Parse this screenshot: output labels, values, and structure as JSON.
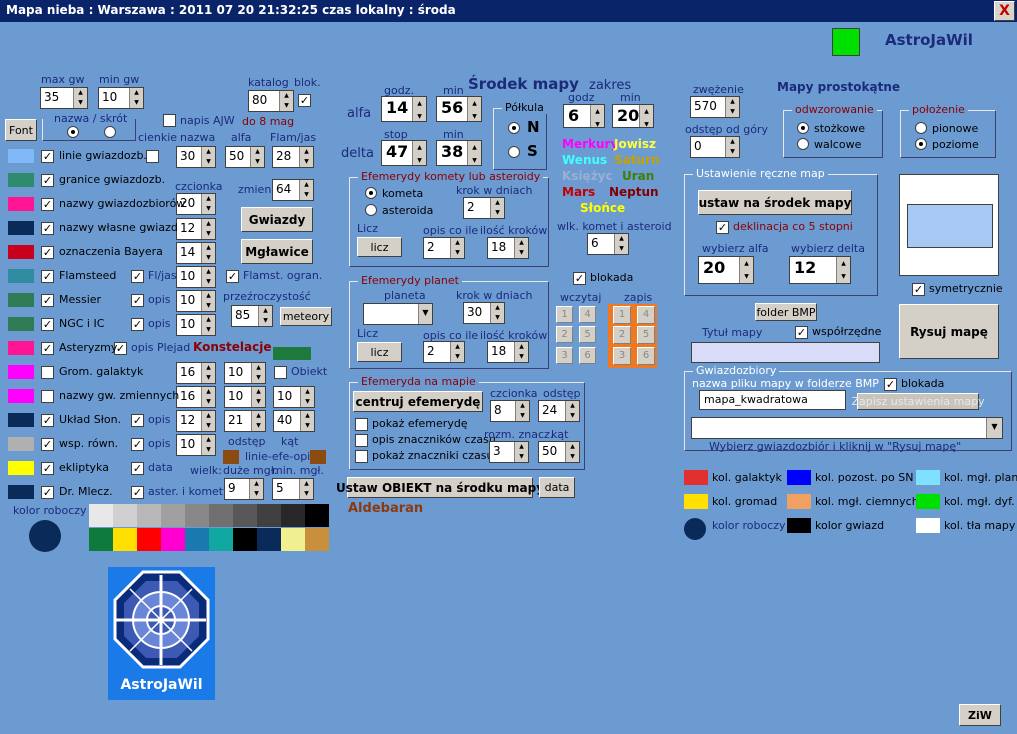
{
  "window": {
    "title": "Mapa nieba  :  Warszawa  :  2011 07 20   21:32:25  czas lokalny  :  środa",
    "close": "X",
    "brand": "AstroJaWil"
  },
  "left": {
    "max_gw_label": "max gw",
    "max_gw": "35",
    "min_gw_label": "min gw",
    "min_gw": "10",
    "katalog_label": "katalog",
    "katalog": "80",
    "blok_label": "blok.",
    "do8mag": "do 8 mag",
    "font_button": "Font",
    "nazwa_skrot": "nazwa / skrót",
    "napis_ajw": "napis AJW",
    "cienkie": "cienkie",
    "nazwa_col": "nazwa",
    "alfa_col": "alfa",
    "flam_jas_col": "Flam/jas",
    "linie_vals": [
      "30",
      "50",
      "28"
    ],
    "czcionka": "czcionka",
    "czcionka_val": "20",
    "zmien": "zmien.",
    "zmien_val": "64",
    "gwiazdy_btn": "Gwiazdy",
    "mglawice_btn": "Mgławice",
    "rows": [
      {
        "label": "linie gwiazdozb.",
        "color": "#80b8f8",
        "checked": true
      },
      {
        "label": "granice gwiazdozb.",
        "color": "#2e8b6e",
        "checked": true
      },
      {
        "label": "nazwy gwiazdozbiorów",
        "color": "#ff1493",
        "checked": true
      },
      {
        "label": "nazwy własne gwiazd",
        "color": "#0a2a5a",
        "checked": true
      },
      {
        "label": "oznaczenia Bayera",
        "color": "#c8001e",
        "checked": true
      },
      {
        "label": "Flamsteed",
        "color": "#2e8ba0",
        "checked": true
      },
      {
        "label": "Messier",
        "color": "#2e7b55",
        "checked": true
      },
      {
        "label": "NGC  i  IC",
        "color": "#2e7b55",
        "checked": true
      },
      {
        "label": "Asteryzmy",
        "color": "#ff1493",
        "checked": true
      },
      {
        "label": "Grom. galaktyk",
        "color": "#ff00ff",
        "checked": false
      },
      {
        "label": "nazwy gw. zmiennych",
        "color": "#ff00ff",
        "checked": false
      },
      {
        "label": "Układ Słon.",
        "color": "#0a2a5a",
        "checked": true
      },
      {
        "label": "wsp. równ.",
        "color": "#b0b0b0",
        "checked": true
      },
      {
        "label": "ekliptyka",
        "color": "#ffff00",
        "checked": true
      },
      {
        "label": "Dr. Mlecz.",
        "color": "#0a2a5a",
        "checked": true
      }
    ],
    "vals_col1": [
      "12",
      "14",
      "10",
      "10",
      "10",
      "16",
      "16",
      "12",
      "10"
    ],
    "flj": "Fl/jas",
    "flamst": "Flamst. ogran.",
    "przezr": "przeźroczystość",
    "przezr_val": "85",
    "meteory": "meteory",
    "opis": "opis",
    "opis_plejad": "opis Plejad",
    "konstelacje": "Konstelacje",
    "grom_vals": [
      "10",
      "10"
    ],
    "obiekt": "Obiekt",
    "zmien_vals": [
      "10",
      "10"
    ],
    "uklad_vals": [
      "21",
      "40"
    ],
    "odstep": "odstęp",
    "kat": "kąt",
    "linie_efe": "linie-efe-opis",
    "data": "data",
    "wielk": "wielk:",
    "duze": "duże mgł.",
    "min_mgl": "min. mgł.",
    "aster": "aster. i komety",
    "duze_val": "9",
    "min_val": "5",
    "kolor_roboczy": "kolor roboczy",
    "palette1": [
      "#e8e8e8",
      "#d0d0d0",
      "#b8b8b8",
      "#a0a0a0",
      "#888888",
      "#707070",
      "#585858",
      "#404040",
      "#282828",
      "#000000"
    ],
    "palette2": [
      "#0e7a3c",
      "#ffe000",
      "#ff0000",
      "#ff00d0",
      "#1a7ab0",
      "#10a8a0",
      "#000000",
      "#0a2a5a",
      "#f0f090",
      "#c8903a"
    ],
    "logo_text": "AstroJaWil"
  },
  "mid": {
    "title": "Środek mapy",
    "zakres": "zakres",
    "alfa": "alfa",
    "delta": "delta",
    "godz": "godz.",
    "min": "min",
    "stop": "stop",
    "alfa_h": "14",
    "alfa_m": "56",
    "delta_d": "47",
    "delta_m": "38",
    "polkula": "Półkula",
    "n": "N",
    "s": "S",
    "godz2": "godz",
    "min2": "min",
    "zakres_h": "6",
    "zakres_m": "20",
    "planets": [
      {
        "name": "Merkury",
        "color": "#ff00ff"
      },
      {
        "name": "Jowisz",
        "color": "#ffff40"
      },
      {
        "name": "Wenus",
        "color": "#40ffff"
      },
      {
        "name": "Saturn",
        "color": "#c8a000"
      },
      {
        "name": "Księżyc",
        "color": "#9ab0d0"
      },
      {
        "name": "Uran",
        "color": "#408000"
      },
      {
        "name": "Mars",
        "color": "#c00000"
      },
      {
        "name": "Neptun",
        "color": "#800000"
      },
      {
        "name": "Słońce",
        "color": "#ffff00"
      }
    ],
    "komety_title": "Efemerydy komety lub asteroidy",
    "kometa": "kometa",
    "asteroida": "asteroida",
    "krok": "krok w dniach",
    "krok_val": "2",
    "licz": "Licz",
    "licz_btn": "licz",
    "opis_co_ile": "opis co ile",
    "ilosc": "ilość kroków",
    "opis_val": "2",
    "ilosc_val": "18",
    "wlk": "wlk. komet i asteroid",
    "wlk_val": "6",
    "planety_title": "Efemerydy planet",
    "planeta": "planeta",
    "krok2_val": "30",
    "opis2_val": "2",
    "ilosc2_val": "18",
    "blokada": "blokada",
    "wczytaj": "wczytaj",
    "zapis": "zapis",
    "wczytaj_grid": [
      "1",
      "4",
      "2",
      "5",
      "3",
      "6"
    ],
    "zapis_grid": [
      "1",
      "4",
      "2",
      "5",
      "3",
      "6"
    ],
    "efem_title": "Efemeryda na mapie",
    "centruj": "centruj efemerydę",
    "czcionka": "czcionka",
    "odstep": "odstęp",
    "czc_val": "8",
    "odst_val": "24",
    "pokaz1": "pokaż efemerydę",
    "pokaz2": "opis znaczników czasu",
    "pokaz3": "pokaż znaczniki czasu",
    "rozm": "rozm. znacz.",
    "kat": "kąt",
    "rozm_val": "3",
    "kat_val": "50",
    "ustaw_btn": "Ustaw OBIEKT na środku mapy",
    "data_btn": "data",
    "obiekt": "Aldebaran"
  },
  "right": {
    "zwezenie": "zwężenie",
    "zwezenie_val": "570",
    "odstep_od_gory": "odstęp od góry",
    "odstep_val": "0",
    "mapy_prost": "Mapy prostokątne",
    "odwz": "odwzorowanie",
    "stozkowe": "stożkowe",
    "walcowe": "walcowe",
    "polozenie": "położenie",
    "pionowe": "pionowe",
    "poziome": "poziome",
    "reczne": "Ustawienie ręczne map",
    "ustaw_srodek": "ustaw na środek mapy",
    "deklinacja": "deklinacja co 5 stopni",
    "wybierz_alfa": "wybierz alfa",
    "wybierz_delta": "wybierz delta",
    "alfa_val": "20",
    "delta_val": "12",
    "symetryczne": "symetrycznie",
    "folder_bmp": "folder BMP",
    "tytul": "Tytuł mapy",
    "wspolrzedne": "współrzędne",
    "rysuj": "Rysuj mapę",
    "gwiazdozbiory": "Gwiazdozbiory",
    "nazwa_pliku": "nazwa pliku mapy w folderze BMP",
    "blokada": "blokada",
    "plik_val": "mapa_kwadratowa",
    "zapisz": "Zapisz ustawienia mapy",
    "wybierz_info": "Wybierz gwiazdozbiór i kliknij w \"Rysuj mapę\"",
    "colors": [
      {
        "label": "kol. galaktyk",
        "color": "#e03030"
      },
      {
        "label": "kol. pozost. po SN",
        "color": "#0000ff"
      },
      {
        "label": "kol. mgł. plan.",
        "color": "#80e0ff"
      },
      {
        "label": "kol. gromad",
        "color": "#ffe000"
      },
      {
        "label": "kol. mgł. ciemnych",
        "color": "#f0a060"
      },
      {
        "label": "kol. mgł. dyf.",
        "color": "#00e000"
      },
      {
        "label": "kolor roboczy",
        "color": "#0a2a5a"
      },
      {
        "label": "kolor gwiazd",
        "color": "#000000"
      },
      {
        "label": "kol. tła mapy",
        "color": "#ffffff"
      }
    ],
    "ziw": "ZiW"
  }
}
